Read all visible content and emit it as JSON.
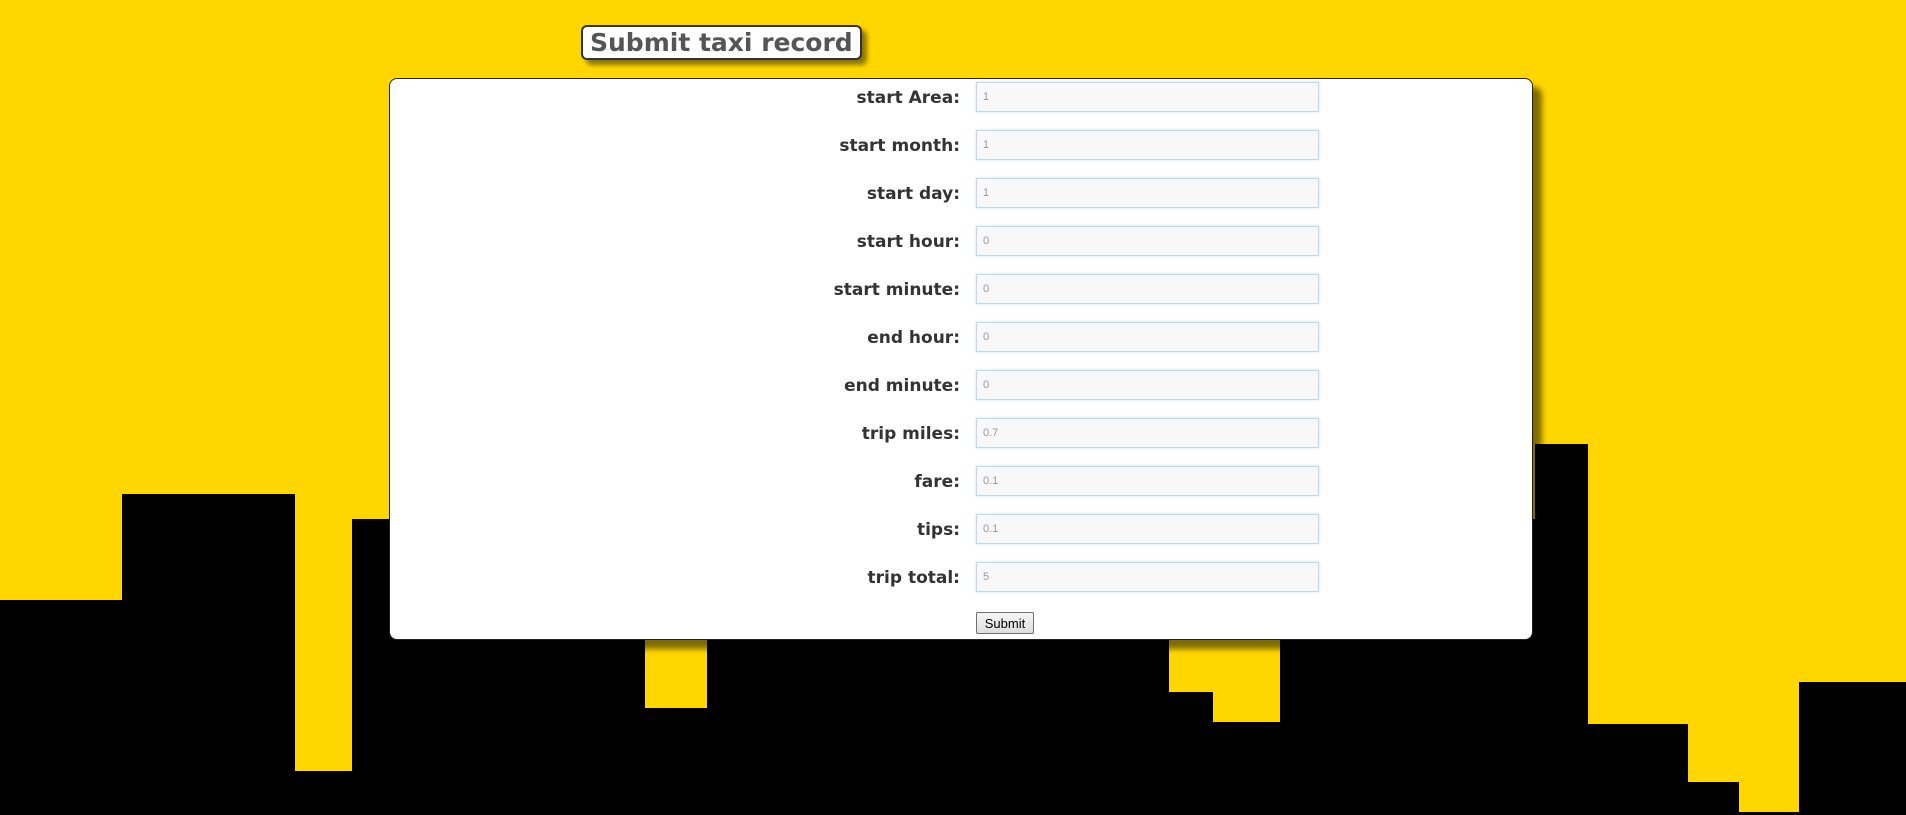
{
  "header": {
    "title": "Submit taxi record"
  },
  "colors": {
    "background": "#FFD600",
    "skyline": "#000000",
    "panel": "#FFFFFF"
  },
  "form": {
    "fields": [
      {
        "label": "start Area:",
        "value": "1"
      },
      {
        "label": "start month:",
        "value": "1"
      },
      {
        "label": "start day:",
        "value": "1"
      },
      {
        "label": "start hour:",
        "value": "0"
      },
      {
        "label": "start minute:",
        "value": "0"
      },
      {
        "label": "end hour:",
        "value": "0"
      },
      {
        "label": "end minute:",
        "value": "0"
      },
      {
        "label": "trip miles:",
        "value": "0.7"
      },
      {
        "label": "fare:",
        "value": "0.1"
      },
      {
        "label": "tips:",
        "value": "0.1"
      },
      {
        "label": "trip total:",
        "value": "5"
      }
    ],
    "submit_label": "Submit"
  }
}
